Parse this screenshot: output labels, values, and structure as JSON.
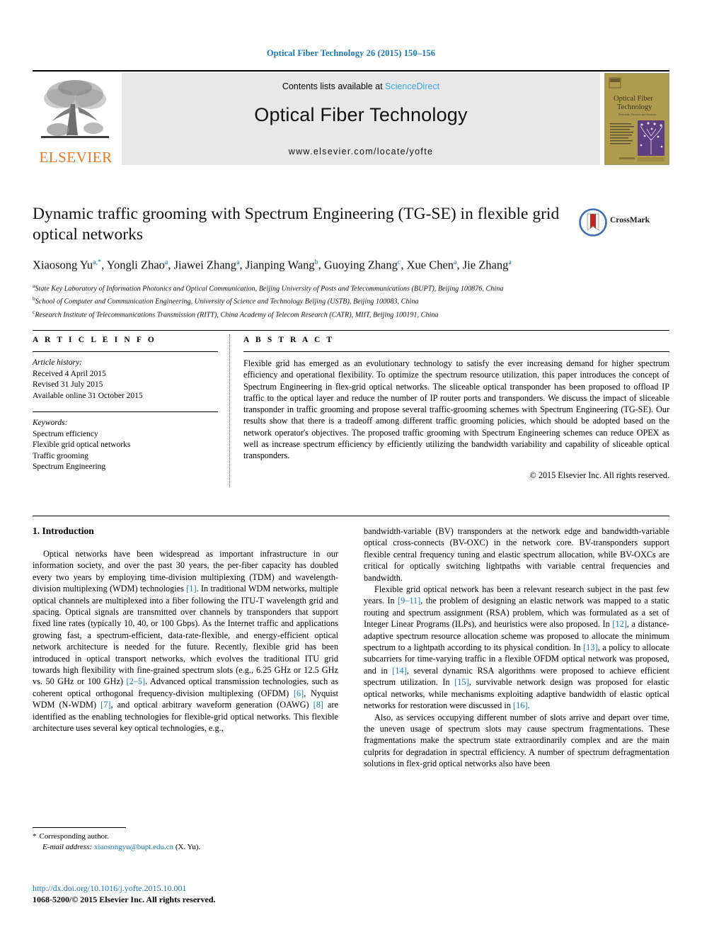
{
  "running_head": "Optical Fiber Technology 26 (2015) 150–156",
  "masthead": {
    "publisher_logo_label": "ELSEVIER",
    "contents_prefix": "Contents lists available at ",
    "contents_link": "ScienceDirect",
    "journal_title": "Optical Fiber Technology",
    "journal_url": "www.elsevier.com/locate/yofte",
    "cover": {
      "line1": "Optical Fiber",
      "line2": "Technology",
      "tagline": "Materials, Devices and Systems"
    }
  },
  "title_block": {
    "title": "Dynamic traffic grooming with Spectrum Engineering (TG-SE) in flexible grid optical networks",
    "crossmark_label": "CrossMark",
    "authors": [
      {
        "name": "Xiaosong Yu",
        "marks": "a,*"
      },
      {
        "name": "Yongli Zhao",
        "marks": "a"
      },
      {
        "name": "Jiawei Zhang",
        "marks": "a"
      },
      {
        "name": "Jianping Wang",
        "marks": "b"
      },
      {
        "name": "Guoying Zhang",
        "marks": "c"
      },
      {
        "name": "Xue Chen",
        "marks": "a"
      },
      {
        "name": "Jie Zhang",
        "marks": "a"
      }
    ],
    "affiliations": [
      {
        "mark": "a",
        "text": "State Key Laboratory of Information Photonics and Optical Communication, Beijing University of Posts and Telecommunications (BUPT), Beijing 100876, China"
      },
      {
        "mark": "b",
        "text": "School of Computer and Communication Engineering, University of Science and Technology Beijing (USTB), Beijing 100083, China"
      },
      {
        "mark": "c",
        "text": "Research Institute of Telecommunications Transmission (RITT), China Academy of Telecom Research (CATR), MIIT, Beijing 100191, China"
      }
    ]
  },
  "article_info": {
    "heading": "A R T I C L E    I N F O",
    "history_heading": "Article history:",
    "history": [
      "Received 4 April 2015",
      "Revised 31 July 2015",
      "Available online 31 October 2015"
    ],
    "keywords_heading": "Keywords:",
    "keywords": [
      "Spectrum efficiency",
      "Flexible grid optical networks",
      "Traffic grooming",
      "Spectrum Engineering"
    ]
  },
  "abstract": {
    "heading": "A B S T R A C T",
    "text": "Flexible grid has emerged as an evolutionary technology to satisfy the ever increasing demand for higher spectrum efficiency and operational flexibility. To optimize the spectrum resource utilization, this paper introduces the concept of Spectrum Engineering in flex-grid optical networks. The sliceable optical transponder has been proposed to offload IP traffic to the optical layer and reduce the number of IP router ports and transponders. We discuss the impact of sliceable transponder in traffic grooming and propose several traffic-grooming schemes with Spectrum Engineering (TG-SE). Our results show that there is a tradeoff among different traffic grooming policies, which should be adopted based on the network operator's objectives. The proposed traffic grooming with Spectrum Engineering schemes can reduce OPEX as well as increase spectrum efficiency by efficiently utilizing the bandwidth variability and capability of sliceable optical transponders.",
    "copyright": "© 2015 Elsevier Inc. All rights reserved."
  },
  "body": {
    "section_title": "1. Introduction",
    "left_paragraphs": [
      "Optical networks have been widespread as important infrastructure in our information society, and over the past 30 years, the per-fiber capacity has doubled every two years by employing time-division multiplexing (TDM) and wavelength-division multiplexing (WDM) technologies [1]. In traditional WDM networks, multiple optical channels are multiplexed into a fiber following the ITU-T wavelength grid and spacing. Optical signals are transmitted over channels by transponders that support fixed line rates (typically 10, 40, or 100 Gbps). As the Internet traffic and applications growing fast, a spectrum-efficient, data-rate-flexible, and energy-efficient optical network architecture is needed for the future. Recently, flexible grid has been introduced in optical transport networks, which evolves the traditional ITU grid towards high flexibility with fine-grained spectrum slots (e.g., 6.25 GHz or 12.5 GHz vs. 50 GHz or 100 GHz) [2–5]. Advanced optical transmission technologies, such as coherent optical orthogonal frequency-division multiplexing (OFDM) [6], Nyquist WDM (N-WDM) [7], and optical arbitrary waveform generation (OAWG) [8] are identified as the enabling technologies for flexible-grid optical networks. This flexible architecture uses several key optical technologies, e.g.,"
    ],
    "right_paragraphs": [
      "bandwidth-variable (BV) transponders at the network edge and bandwidth-variable optical cross-connects (BV-OXC) in the network core. BV-transponders support flexible central frequency tuning and elastic spectrum allocation, while BV-OXCs are critical for optically switching lightpaths with variable central frequencies and bandwidth.",
      "Flexible grid optical network has been a relevant research subject in the past few years. In [9–11], the problem of designing an elastic network was mapped to a static routing and spectrum assignment (RSA) problem, which was formulated as a set of Integer Linear Programs (ILPs), and heuristics were also proposed. In [12], a distance-adaptive spectrum resource allocation scheme was proposed to allocate the minimum spectrum to a lightpath according to its physical condition. In [13], a policy to allocate subcarriers for time-varying traffic in a flexible OFDM optical network was proposed, and in [14], several dynamic RSA algorithms were proposed to achieve efficient spectrum utilization. In [15], survivable network design was proposed for elastic optical networks, while mechanisms exploiting adaptive bandwidth of elastic optical networks for restoration were discussed in [16].",
      "Also, as services occupying different number of slots arrive and depart over time, the uneven usage of spectrum slots may cause spectrum fragmentations. These fragmentations make the spectrum state extraordinarily complex and are the main culprits for degradation in spectral efficiency. A number of spectrum defragmentation solutions in flex-grid optical networks also have been"
    ]
  },
  "footnote": {
    "star": "*",
    "corresponding": "Corresponding author.",
    "email_label": "E-mail address:",
    "email": "xiaosongyu@bupt.edu.cn",
    "email_suffix": "(X. Yu)."
  },
  "footer": {
    "doi": "http://dx.doi.org/10.1016/j.yofte.2015.10.001",
    "issn_copyright": "1068-5200/© 2015 Elsevier Inc. All rights reserved."
  },
  "colors": {
    "link": "#1b75bb",
    "sciencedirect": "#3aa6dd",
    "elsevier_orange": "#e87722",
    "band_gray": "#e8e8e8",
    "cover_bg": "#b09a4e",
    "cover_purple": "#6b4b8a"
  }
}
